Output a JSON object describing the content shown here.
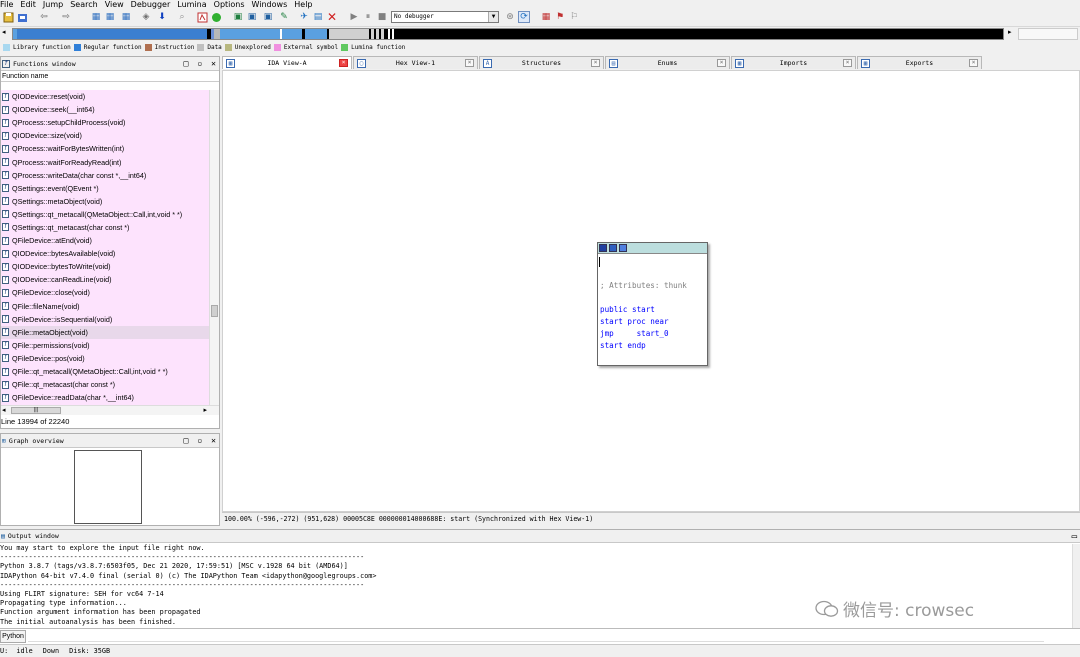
{
  "menu": [
    "File",
    "Edit",
    "Jump",
    "Search",
    "View",
    "Debugger",
    "Lumina",
    "Options",
    "Windows",
    "Help"
  ],
  "toolbar": {
    "debugger_select": "No debugger",
    "icons": [
      "save-icon",
      "open-icon",
      "back-icon",
      "forward-icon",
      "binary-icon",
      "text-search-icon",
      "find-icon",
      "down-arrow-icon",
      "run-icon",
      "graph-icon",
      "stop-icon",
      "play-icon",
      "pause-icon",
      "stop-debug-icon",
      "grid-icon",
      "flag-icon",
      "breakpoint-icon"
    ]
  },
  "navband": {
    "segments": [
      {
        "color": "#5aa0e0",
        "w": 4
      },
      {
        "color": "#3b7fd0",
        "w": 190
      },
      {
        "color": "#000000",
        "w": 4
      },
      {
        "color": "#6b8fd8",
        "w": 3
      },
      {
        "color": "#b8b8b8",
        "w": 6
      },
      {
        "color": "#5aa0e0",
        "w": 60
      },
      {
        "color": "#ffffff",
        "w": 2
      },
      {
        "color": "#5aa0e0",
        "w": 20
      },
      {
        "color": "#000000",
        "w": 3
      },
      {
        "color": "#5aa0e0",
        "w": 22
      },
      {
        "color": "#000000",
        "w": 2
      },
      {
        "color": "#d0d0d0",
        "w": 40
      },
      {
        "color": "#000000",
        "w": 2
      },
      {
        "color": "#d0d0d0",
        "w": 3
      },
      {
        "color": "#000000",
        "w": 2
      },
      {
        "color": "#d0d0d0",
        "w": 3
      },
      {
        "color": "#000000",
        "w": 2
      },
      {
        "color": "#d0d0d0",
        "w": 3
      },
      {
        "color": "#000000",
        "w": 4
      },
      {
        "color": "#ffffff",
        "w": 2
      },
      {
        "color": "#000000",
        "w": 2
      },
      {
        "color": "#ffffff",
        "w": 2
      },
      {
        "color": "#000000",
        "w": 612
      }
    ]
  },
  "legend": [
    {
      "label": "Library function",
      "color": "#a8d8f0"
    },
    {
      "label": "Regular function",
      "color": "#2f7fd8"
    },
    {
      "label": "Instruction",
      "color": "#b07050"
    },
    {
      "label": "Data",
      "color": "#c0c0c0"
    },
    {
      "label": "Unexplored",
      "color": "#b8b880"
    },
    {
      "label": "External symbol",
      "color": "#f090e0"
    },
    {
      "label": "Lumina function",
      "color": "#60c860"
    }
  ],
  "functions_window": {
    "title": "Functions window",
    "column": "Function name",
    "selected_index": 18,
    "items": [
      "QIODevice::reset(void)",
      "QIODevice::seek(__int64)",
      "QProcess::setupChildProcess(void)",
      "QIODevice::size(void)",
      "QProcess::waitForBytesWritten(int)",
      "QProcess::waitForReadyRead(int)",
      "QProcess::writeData(char const *,__int64)",
      "QSettings::event(QEvent *)",
      "QSettings::metaObject(void)",
      "QSettings::qt_metacall(QMetaObject::Call,int,void * *)",
      "QSettings::qt_metacast(char const *)",
      "QFileDevice::atEnd(void)",
      "QIODevice::bytesAvailable(void)",
      "QIODevice::bytesToWrite(void)",
      "QIODevice::canReadLine(void)",
      "QFileDevice::close(void)",
      "QFile::fileName(void)",
      "QFileDevice::isSequential(void)",
      "QFile::metaObject(void)",
      "QFile::permissions(void)",
      "QFileDevice::pos(void)",
      "QFile::qt_metacall(QMetaObject::Call,int,void * *)",
      "QFile::qt_metacast(char const *)",
      "QFileDevice::readData(char *,__int64)"
    ],
    "line_info": "Line 13994 of 22240"
  },
  "graph_overview": {
    "title": "Graph overview"
  },
  "tabs": [
    {
      "label": "IDA View-A",
      "icon": "graph-view-icon",
      "active": true
    },
    {
      "label": "Hex View-1",
      "icon": "hex-icon",
      "active": false
    },
    {
      "label": "Structures",
      "icon": "structures-icon",
      "active": false
    },
    {
      "label": "Enums",
      "icon": "enums-icon",
      "active": false
    },
    {
      "label": "Imports",
      "icon": "imports-icon",
      "active": false
    },
    {
      "label": "Exports",
      "icon": "exports-icon",
      "active": false
    }
  ],
  "node": {
    "comment": "; Attributes: thunk",
    "lines": [
      "public start",
      "start proc near",
      "jmp     start_0",
      "start endp"
    ]
  },
  "ida_status": "100.00% (-596,-272) (951,628) 00005C8E 000000014000688E: start (Synchronized with Hex View-1)",
  "output_window": {
    "title": "Output window",
    "lines": [
      "You may start to explore the input file right now.",
      "-----------------------------------------------------------------------------------------",
      "Python 3.8.7 (tags/v3.8.7:6503f05, Dec 21 2020, 17:59:51) [MSC v.1928 64 bit (AMD64)]",
      "IDAPython 64-bit v7.4.0 final (serial 0) (c) The IDAPython Team <idapython@googlegroups.com>",
      "-----------------------------------------------------------------------------------------",
      "Using FLIRT signature: SEH for vc64 7-14",
      "Propagating type information...",
      "Function argument information has been propagated",
      "The initial autoanalysis has been finished."
    ]
  },
  "watermark": "微信号: crowsec",
  "python_button": "Python",
  "status": {
    "au": "U:  idle",
    "dir": "Down",
    "disk": "Disk: 35GB"
  }
}
